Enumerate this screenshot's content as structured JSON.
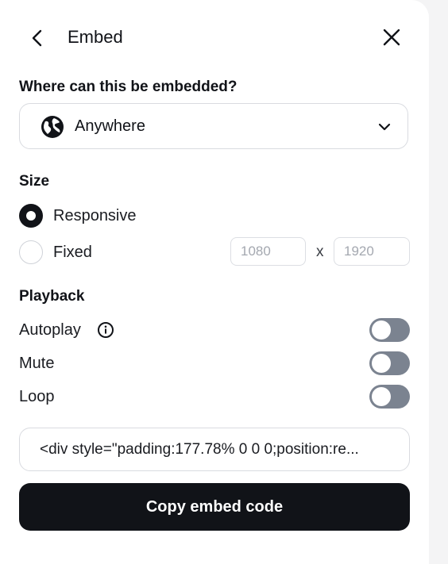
{
  "header": {
    "title": "Embed",
    "back_icon": "chevron-left-icon",
    "close_icon": "close-icon"
  },
  "embed_location": {
    "label": "Where can this be embedded?",
    "selected": "Anywhere",
    "icon": "globe-icon",
    "dropdown_icon": "chevron-down-icon"
  },
  "size": {
    "label": "Size",
    "options": [
      {
        "label": "Responsive",
        "selected": true
      },
      {
        "label": "Fixed",
        "selected": false
      }
    ],
    "width_placeholder": "1080",
    "height_placeholder": "1920",
    "separator": "x"
  },
  "playback": {
    "label": "Playback",
    "options": [
      {
        "label": "Autoplay",
        "enabled": false,
        "has_info": true
      },
      {
        "label": "Mute",
        "enabled": false
      },
      {
        "label": "Loop",
        "enabled": false
      }
    ]
  },
  "code": {
    "value": "<div style=\"padding:177.78% 0 0 0;position:re..."
  },
  "copy_button": {
    "label": "Copy embed code"
  },
  "colors": {
    "primary": "#111318",
    "toggle_off": "#7b8390",
    "border": "#d9dbe0"
  }
}
